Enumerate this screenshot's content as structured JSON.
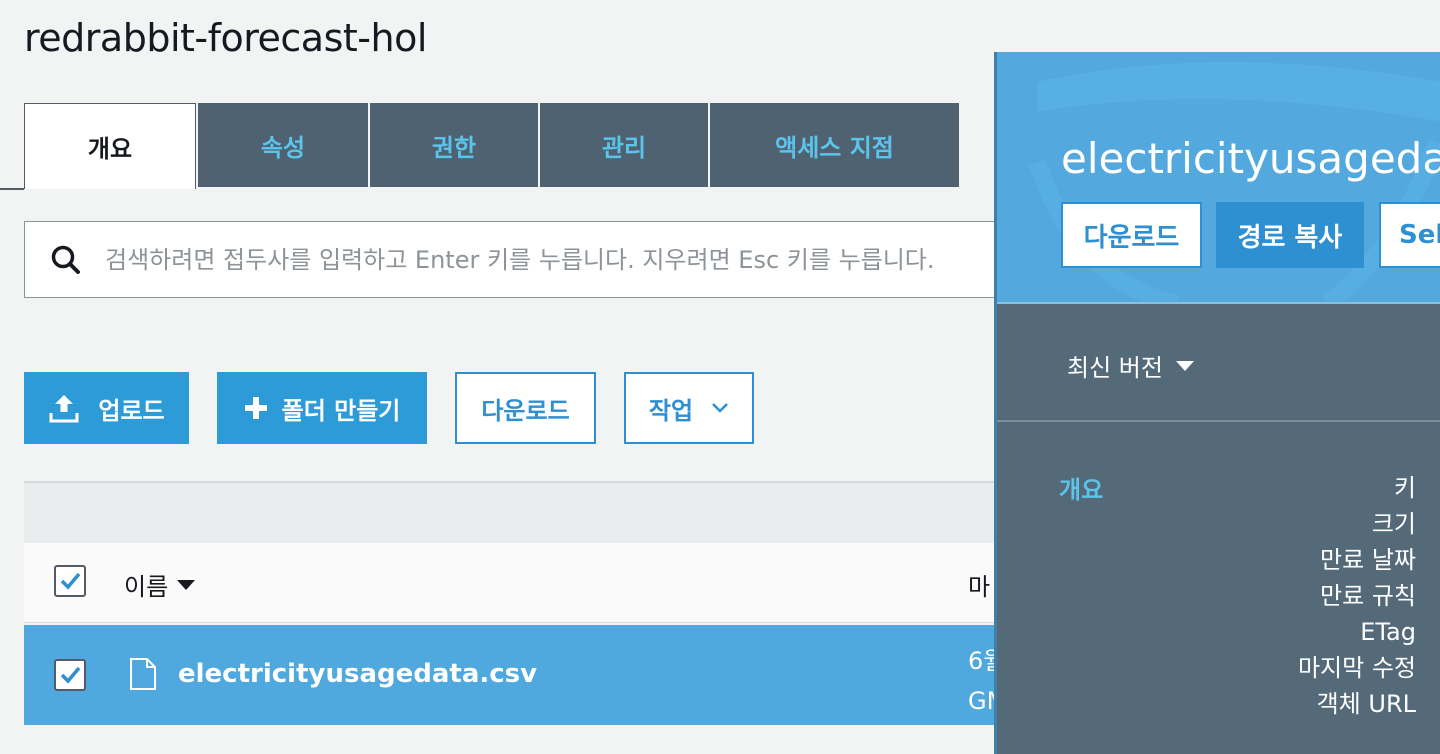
{
  "bucket": {
    "title": "redrabbit-forecast-hol"
  },
  "tabs": [
    {
      "label": "개요",
      "active": true
    },
    {
      "label": "속성",
      "active": false
    },
    {
      "label": "권한",
      "active": false
    },
    {
      "label": "관리",
      "active": false
    },
    {
      "label": "액세스 지점",
      "active": false
    }
  ],
  "search": {
    "placeholder": "검색하려면 접두사를 입력하고 Enter 키를 누릅니다. 지우려면 Esc 키를 누릅니다."
  },
  "toolbar": {
    "upload_label": "업로드",
    "create_folder_label": "폴더 만들기",
    "download_label": "다운로드",
    "actions_label": "작업"
  },
  "table": {
    "header": {
      "name_label": "이름",
      "modified_label": "마"
    },
    "rows": [
      {
        "name": "electricityusagedata.csv",
        "date_line1": "6월",
        "date_line2": "GM",
        "selected": true
      }
    ]
  },
  "panel": {
    "title": "electricityusagedata",
    "download_label": "다운로드",
    "copy_path_label": "경로 복사",
    "select_label": "Sele",
    "version_label": "최신 버전",
    "section_label": "개요",
    "properties": [
      "키",
      "크기",
      "만료 날짜",
      "만료 규칙",
      "ETag",
      "마지막 수정",
      "객체 URL"
    ]
  },
  "colors": {
    "accent": "#2e9bd9",
    "tab_inactive_bg": "#4e6272",
    "tab_inactive_text": "#5cc3ea",
    "selected_row": "#4fa8de",
    "panel_bg": "#546a79",
    "panel_header": "#53a8de"
  }
}
